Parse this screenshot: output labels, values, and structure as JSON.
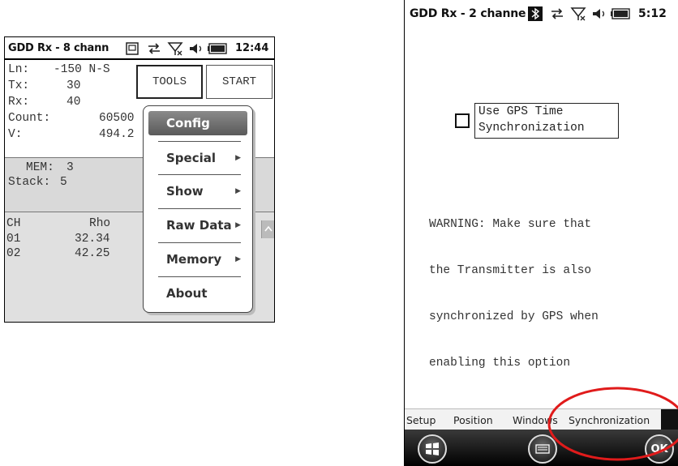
{
  "left_screen": {
    "title": "GDD Rx - 8 chann",
    "time": "12:44",
    "fields": {
      "ln_label": "Ln:",
      "ln_value": "-150 N-S",
      "tx_label": "Tx:",
      "tx_value": "30",
      "rx_label": "Rx:",
      "rx_value": "40",
      "count_label": "Count:",
      "count_value": "60500",
      "v_label": "V:",
      "v_value": "494.2"
    },
    "buttons": {
      "tools": "TOOLS",
      "start": "START"
    },
    "mem": {
      "mem_label": "MEM:",
      "mem_value": "3",
      "stack_label": "Stack:",
      "stack_value": "5"
    },
    "table": {
      "headers": [
        "CH",
        "Rho"
      ],
      "rows": [
        [
          "01",
          "32.34"
        ],
        [
          "02",
          "42.25"
        ]
      ]
    },
    "menu": {
      "items": [
        {
          "label": "Config",
          "submenu": false,
          "selected": true
        },
        {
          "label": "Special",
          "submenu": true
        },
        {
          "label": "Show",
          "submenu": true
        },
        {
          "label": "Raw Data",
          "submenu": true
        },
        {
          "label": "Memory",
          "submenu": true
        },
        {
          "label": "About",
          "submenu": false
        }
      ]
    }
  },
  "right_screen": {
    "title": "GDD Rx - 2 channe",
    "time": "5:12",
    "checkbox": {
      "label_line1": "Use GPS Time",
      "label_line2": "Synchronization",
      "checked": false
    },
    "warning": [
      "WARNING: Make sure that",
      "the Transmitter is also",
      "synchronized by GPS when",
      "enabling this option"
    ],
    "tabs": [
      "Setup",
      "Position",
      "Windows",
      "Synchronization"
    ],
    "bottom": {
      "ok_label": "OK"
    },
    "highlight_color": "#e01b1b"
  }
}
